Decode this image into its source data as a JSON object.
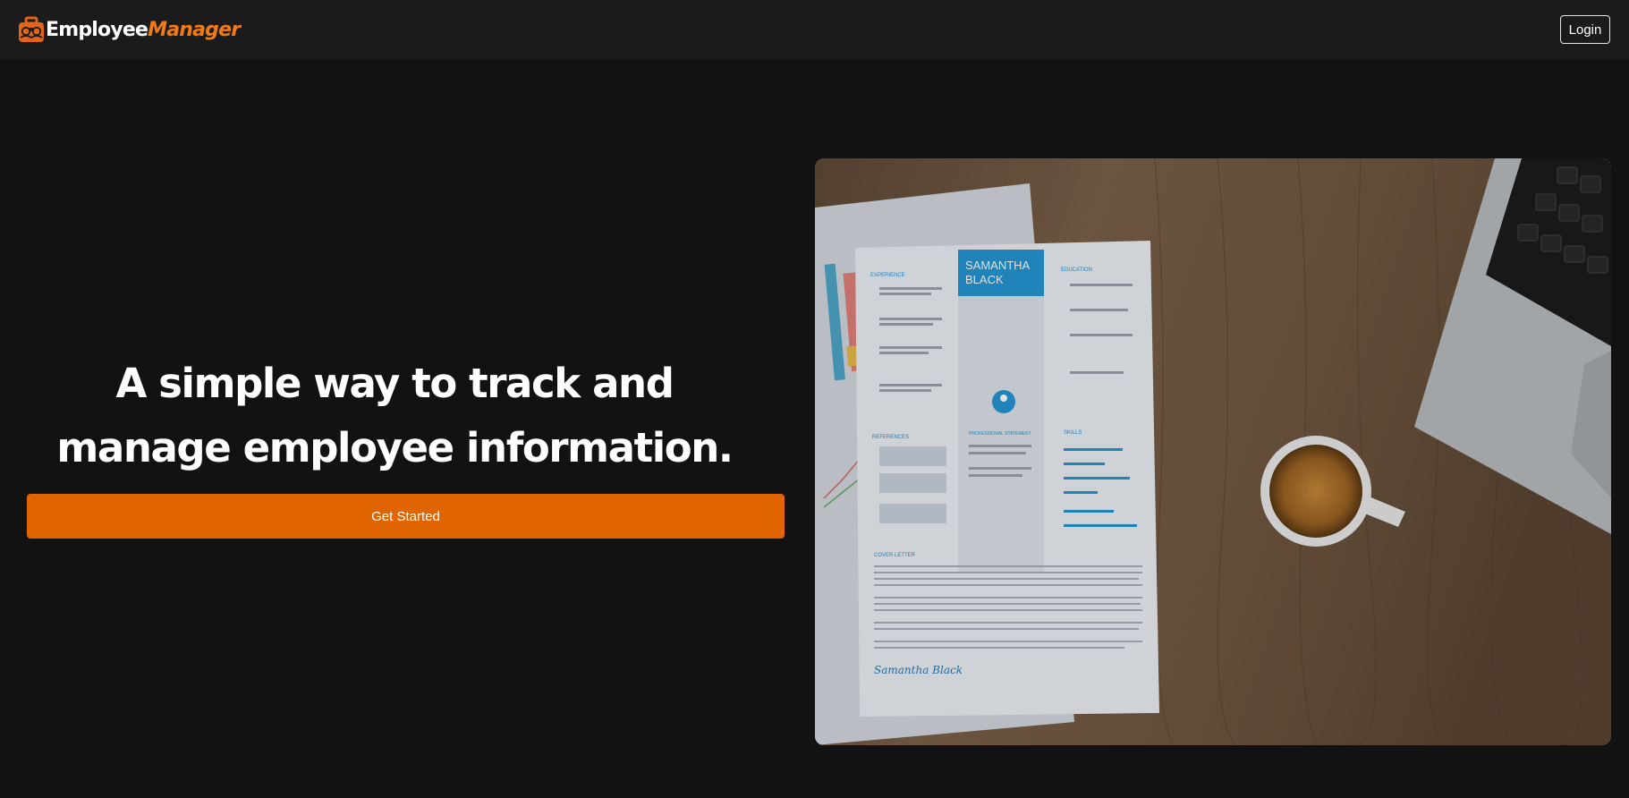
{
  "brand": {
    "name_part1": "Employee",
    "name_part2": "Manager",
    "icon": "briefcase-icon",
    "accent_color": "#f07a15"
  },
  "nav": {
    "login_label": "Login"
  },
  "hero": {
    "headline_line1": "A simple way to track and",
    "headline_line2": "manage employee information.",
    "cta_label": "Get Started",
    "cta_color": "#e06500",
    "image": {
      "resume_name_line1": "SAMANTHA",
      "resume_name_line2": "BLACK",
      "resume_sections": [
        "EXPERIENCE",
        "EDUCATION",
        "REFERENCES",
        "PROFESSIONAL STATEMENT",
        "SKILLS",
        "COVER LETTER"
      ],
      "resume_signature": "Samantha Black"
    }
  }
}
